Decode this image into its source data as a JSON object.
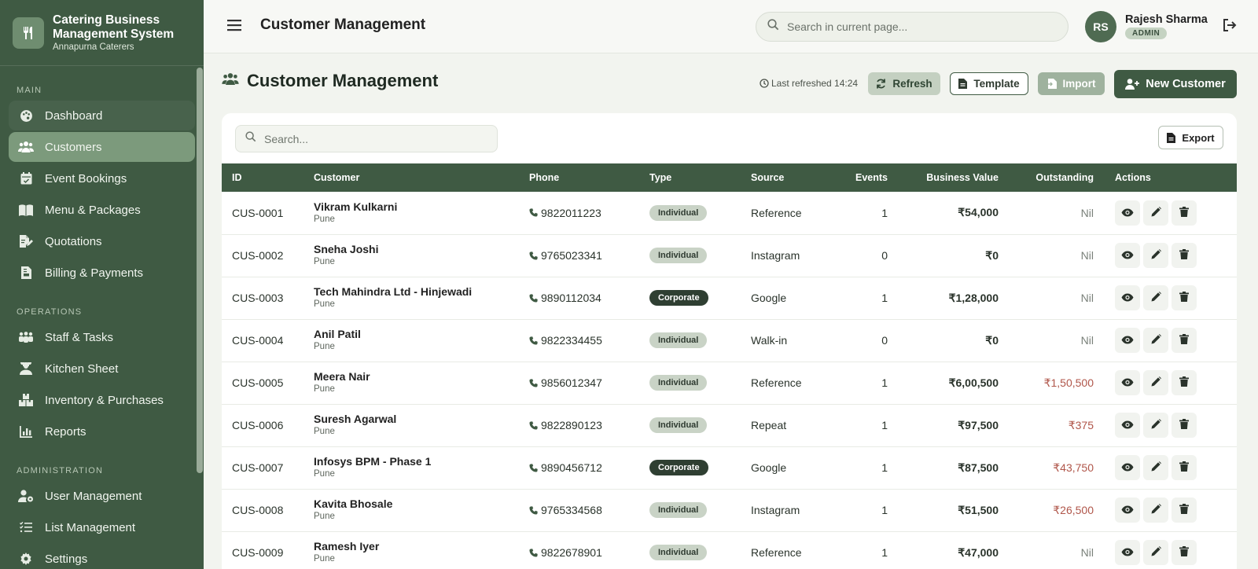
{
  "brand": {
    "title_line1": "Catering Business",
    "title_line2": "Management System",
    "subtitle": "Annapurna Caterers"
  },
  "sidebar": {
    "sections": [
      {
        "label": "MAIN",
        "items": [
          {
            "label": "Dashboard",
            "icon": "palette-icon"
          },
          {
            "label": "Customers",
            "icon": "users-icon",
            "active": true
          },
          {
            "label": "Event Bookings",
            "icon": "calendar-icon"
          },
          {
            "label": "Menu & Packages",
            "icon": "book-icon"
          },
          {
            "label": "Quotations",
            "icon": "file-edit-icon"
          },
          {
            "label": "Billing & Payments",
            "icon": "invoice-icon"
          }
        ]
      },
      {
        "label": "OPERATIONS",
        "items": [
          {
            "label": "Staff & Tasks",
            "icon": "team-icon"
          },
          {
            "label": "Kitchen Sheet",
            "icon": "chef-icon"
          },
          {
            "label": "Inventory & Purchases",
            "icon": "boxes-icon"
          },
          {
            "label": "Reports",
            "icon": "bar-chart-icon"
          }
        ]
      },
      {
        "label": "ADMINISTRATION",
        "items": [
          {
            "label": "User Management",
            "icon": "user-cog-icon"
          },
          {
            "label": "List Management",
            "icon": "list-check-icon"
          },
          {
            "label": "Settings",
            "icon": "gear-icon"
          }
        ]
      }
    ]
  },
  "header": {
    "title": "Customer Management",
    "search_placeholder": "Search in current page...",
    "user": {
      "initials": "RS",
      "name": "Rajesh Sharma",
      "role": "ADMIN"
    }
  },
  "page": {
    "title": "Customer Management",
    "last_refreshed": "Last refreshed 14:24",
    "buttons": {
      "refresh": "Refresh",
      "template": "Template",
      "import": "Import",
      "new_customer": "New Customer",
      "export": "Export"
    },
    "table_search_placeholder": "Search..."
  },
  "table": {
    "columns": [
      "ID",
      "Customer",
      "Phone",
      "Type",
      "Source",
      "Events",
      "Business Value",
      "Outstanding",
      "Actions"
    ],
    "rows": [
      {
        "id": "CUS-0001",
        "name": "Vikram Kulkarni",
        "city": "Pune",
        "phone": "9822011223",
        "type": "Individual",
        "source": "Reference",
        "events": "1",
        "value": "₹54,000",
        "outstanding": "Nil"
      },
      {
        "id": "CUS-0002",
        "name": "Sneha Joshi",
        "city": "Pune",
        "phone": "9765023341",
        "type": "Individual",
        "source": "Instagram",
        "events": "0",
        "value": "₹0",
        "outstanding": "Nil"
      },
      {
        "id": "CUS-0003",
        "name": "Tech Mahindra Ltd - Hinjewadi",
        "city": "Pune",
        "phone": "9890112034",
        "type": "Corporate",
        "source": "Google",
        "events": "1",
        "value": "₹1,28,000",
        "outstanding": "Nil"
      },
      {
        "id": "CUS-0004",
        "name": "Anil Patil",
        "city": "Pune",
        "phone": "9822334455",
        "type": "Individual",
        "source": "Walk-in",
        "events": "0",
        "value": "₹0",
        "outstanding": "Nil"
      },
      {
        "id": "CUS-0005",
        "name": "Meera Nair",
        "city": "Pune",
        "phone": "9856012347",
        "type": "Individual",
        "source": "Reference",
        "events": "1",
        "value": "₹6,00,500",
        "outstanding": "₹1,50,500"
      },
      {
        "id": "CUS-0006",
        "name": "Suresh Agarwal",
        "city": "Pune",
        "phone": "9822890123",
        "type": "Individual",
        "source": "Repeat",
        "events": "1",
        "value": "₹97,500",
        "outstanding": "₹375"
      },
      {
        "id": "CUS-0007",
        "name": "Infosys BPM - Phase 1",
        "city": "Pune",
        "phone": "9890456712",
        "type": "Corporate",
        "source": "Google",
        "events": "1",
        "value": "₹87,500",
        "outstanding": "₹43,750"
      },
      {
        "id": "CUS-0008",
        "name": "Kavita Bhosale",
        "city": "Pune",
        "phone": "9765334568",
        "type": "Individual",
        "source": "Instagram",
        "events": "1",
        "value": "₹51,500",
        "outstanding": "₹26,500"
      },
      {
        "id": "CUS-0009",
        "name": "Ramesh Iyer",
        "city": "Pune",
        "phone": "9822678901",
        "type": "Individual",
        "source": "Reference",
        "events": "1",
        "value": "₹47,000",
        "outstanding": "Nil"
      }
    ]
  },
  "colors": {
    "sidebar": "#3f5a43",
    "accent": "#3f5a43",
    "active_nav": "#7c9a7c",
    "outstanding_due": "#b0564a"
  }
}
